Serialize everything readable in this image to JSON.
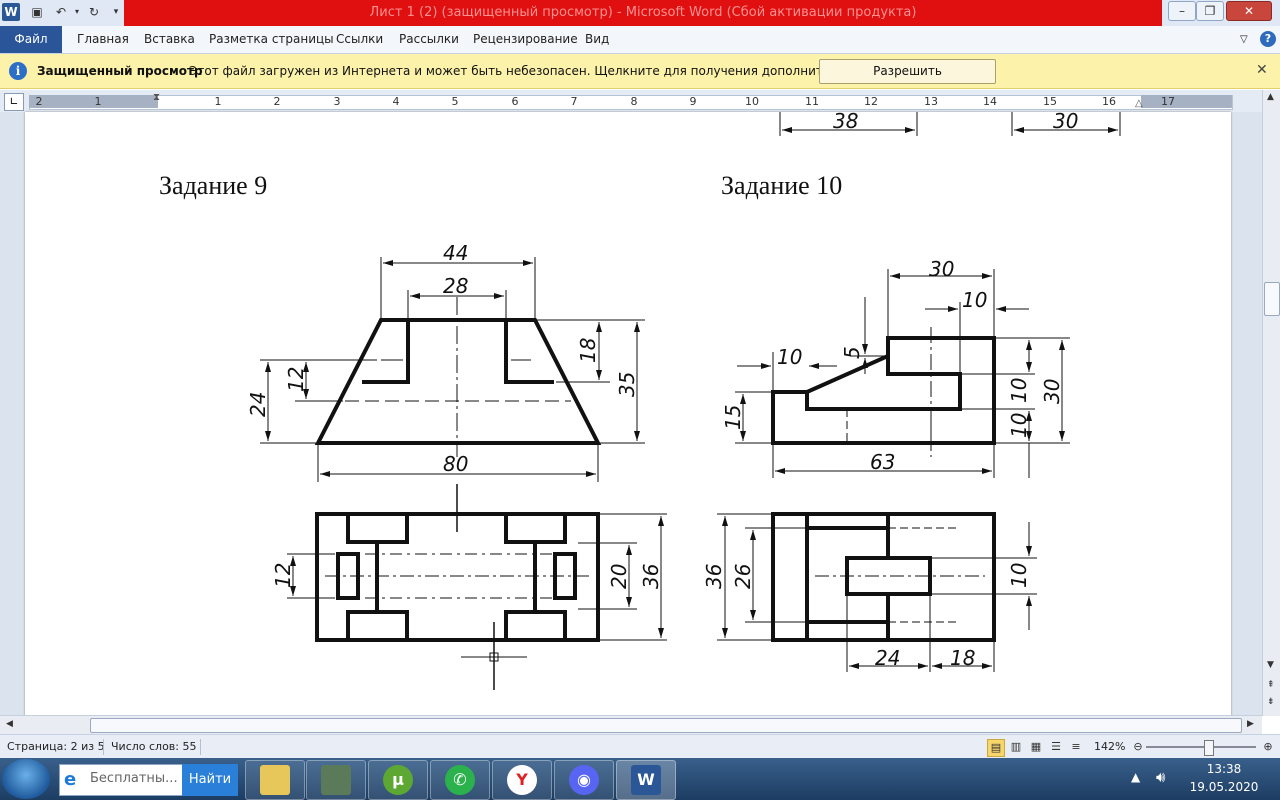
{
  "window": {
    "title": "Лист 1 (2) (защищенный просмотр)  -  Microsoft Word (Сбой активации продукта)",
    "app_logo": "W"
  },
  "ribbon": {
    "file_tab": "Файл",
    "tabs": [
      "Главная",
      "Вставка",
      "Разметка страницы",
      "Ссылки",
      "Рассылки",
      "Рецензирование",
      "Вид"
    ]
  },
  "protected_view": {
    "title": "Защищенный просмотр",
    "message": "Этот файл загружен из Интернета и может быть небезопасен. Щелкните для получения дополнительных сведений.",
    "button": "Разрешить редактирование"
  },
  "ruler": {
    "numbers": [
      "2",
      "1",
      "1",
      "2",
      "3",
      "4",
      "5",
      "6",
      "7",
      "8",
      "9",
      "10",
      "11",
      "12",
      "13",
      "14",
      "15",
      "16",
      "17"
    ]
  },
  "document": {
    "tasks": [
      {
        "heading": "Задание 9",
        "dims": {
          "top_outer": "44",
          "top_inner": "28",
          "right_inner": "18",
          "right_outer": "35",
          "left_inner": "12",
          "left_outer": "24",
          "bottom": "80",
          "plan_left": "12",
          "plan_inner": "20",
          "plan_outer": "36"
        }
      },
      {
        "heading": "Задание 10",
        "dims": {
          "top_outer": "30",
          "top_inner": "10",
          "slope_v": "5",
          "left_top": "10",
          "left_side": "15",
          "right_a": "10",
          "right_b": "10",
          "right_total": "30",
          "bottom": "63",
          "plan_outer": "36",
          "plan_inner": "26",
          "plan_right": "10",
          "plan_bottom_a": "24",
          "plan_bottom_b": "18"
        }
      }
    ],
    "partial_dims": [
      "38",
      "30"
    ]
  },
  "status": {
    "page": "Страница: 2 из 5",
    "words": "Число слов: 55",
    "zoom": "142%"
  },
  "taskbar": {
    "search_text": "Бесплатны...",
    "search_button": "Найти",
    "time": "13:38",
    "date": "19.05.2020"
  }
}
